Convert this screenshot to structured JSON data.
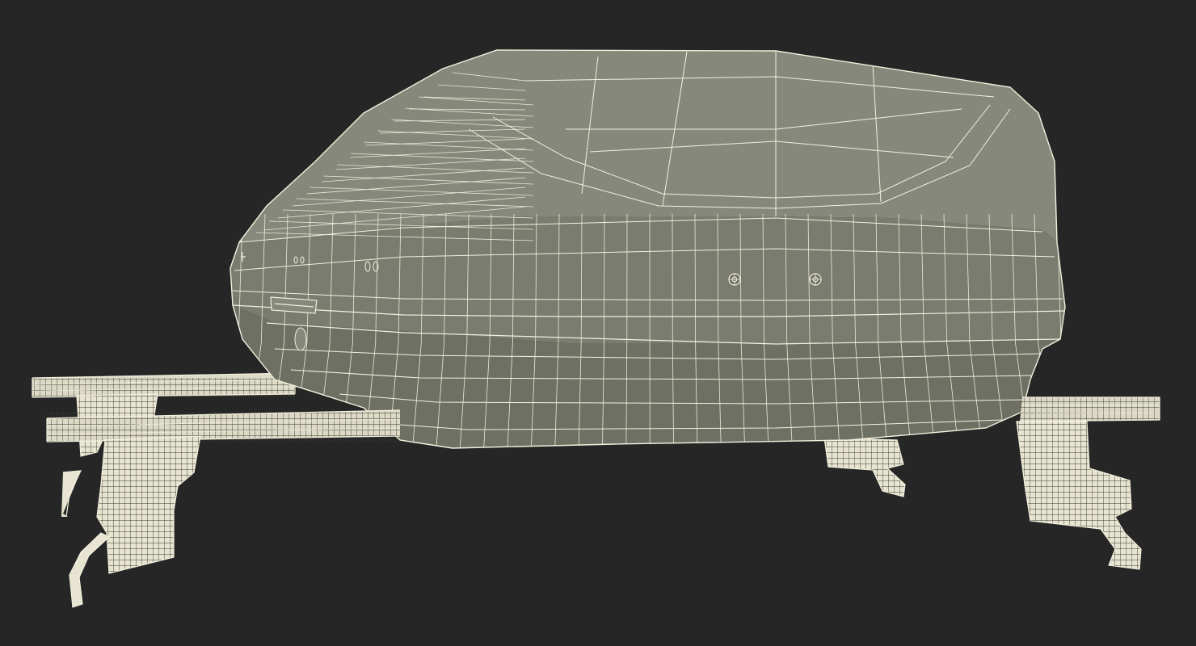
{
  "scene": {
    "subject": "roof-box-with-crossbars-wireframe",
    "render_mode": "wireframe-on-shaded",
    "colors": {
      "background": "#262626",
      "mesh_surface": "#7a7c6f",
      "wire": "#f3f0de"
    },
    "icons": {
      "lock_left": "lock-cylinder-icon",
      "lock_right": "lock-cylinder-icon"
    }
  }
}
